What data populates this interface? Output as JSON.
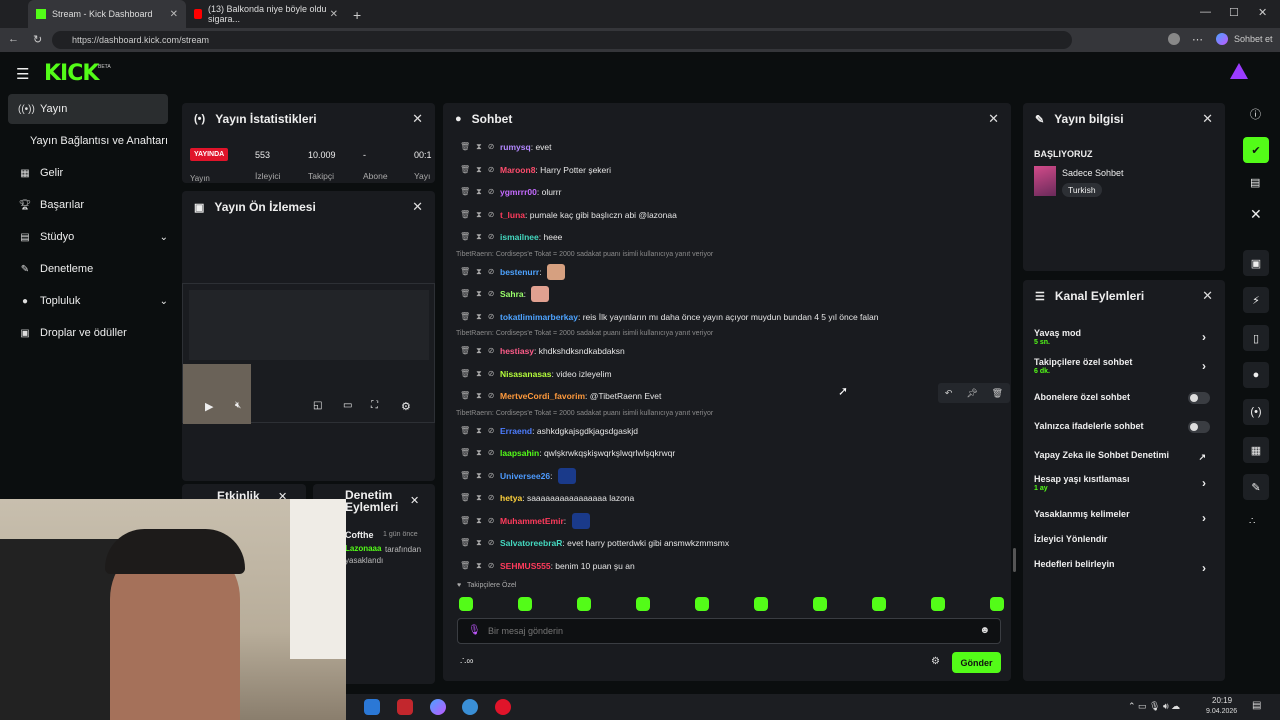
{
  "browser": {
    "tabs": [
      {
        "label": "Stream - Kick Dashboard"
      },
      {
        "label": "(13) Balkonda niye böyle oldu sigara..."
      }
    ],
    "url": "https://dashboard.kick.com/stream",
    "copilot_label": "Sohbet et"
  },
  "kick": {
    "logo": "KICK",
    "beta": "BETA"
  },
  "sidebar": {
    "items": [
      {
        "label": "Yayın",
        "icon": "broadcast-icon"
      },
      {
        "label": "Yayın Bağlantısı ve Anahtarı",
        "icon": ""
      },
      {
        "label": "Gelir",
        "icon": "chart-icon"
      },
      {
        "label": "Başarılar",
        "icon": "trophy-icon"
      },
      {
        "label": "Stüdyo",
        "icon": "studio-icon"
      },
      {
        "label": "Denetleme",
        "icon": "wrench-icon"
      },
      {
        "label": "Topluluk",
        "icon": "people-icon"
      },
      {
        "label": "Droplar ve ödüller",
        "icon": "gift-icon"
      }
    ]
  },
  "stats": {
    "title": "Yayın İstatistikleri",
    "live_badge": "YAYINDA",
    "items": [
      {
        "value": "",
        "label": "Yayın"
      },
      {
        "value": "553",
        "label": "İzleyici"
      },
      {
        "value": "10.009",
        "label": "Takipçi"
      },
      {
        "value": "-",
        "label": "Abone"
      },
      {
        "value": "00:1",
        "label": "Yayı"
      }
    ]
  },
  "preview": {
    "title": "Yayın Ön İzlemesi"
  },
  "etkinlik": {
    "title": "Etkinlik"
  },
  "moderation": {
    "title": "Denetim Eylemleri",
    "user": "Cofthe",
    "time": "1 gün önce",
    "actor": "Lazonaaa",
    "text": "tarafından yasaklandı"
  },
  "chat": {
    "title": "Sohbet",
    "messages": [
      {
        "user": "rumysq",
        "color": "#b388ff",
        "text": "evet"
      },
      {
        "user": "Maroon8",
        "color": "#ff4d6d",
        "text": "Harry Potter şekeri"
      },
      {
        "user": "ygmrrr00",
        "color": "#c56bff",
        "text": "olurrr"
      },
      {
        "user": "t_luna",
        "color": "#ff3b5c",
        "text": "pumale kaç gibi başlıczn abi @lazonaa"
      },
      {
        "user": "ismailnee",
        "color": "#44d9c0",
        "text": "heee"
      },
      {
        "reply": "TibetRaenn: Cordiseps'e Tokat = 2000 sadakat puanı isimli kullanıcıya yanıt veriyor"
      },
      {
        "user": "bestenurr",
        "color": "#4da3ff",
        "text": "",
        "emote": "#d6a080"
      },
      {
        "user": "Sahra",
        "color": "#9aff6b",
        "text": "",
        "emote": "#e0a090"
      },
      {
        "user": "tokatlimimarberkay",
        "color": "#4da3ff",
        "text": "reis İlk yayınların mı daha önce yayın açıyor muydun bundan 4 5 yıl önce falan"
      },
      {
        "reply": "TibetRaenn: Cordiseps'e Tokat = 2000 sadakat puanı isimli kullanıcıya yanıt veriyor"
      },
      {
        "user": "hestiasy",
        "color": "#ff5c8a",
        "text": "khdkshdksndkabdaksn"
      },
      {
        "user": "Nisasanasas",
        "color": "#b6ff3b",
        "text": "video izleyelim"
      },
      {
        "user": "MertveCordi_favorim",
        "color": "#ff9a3c",
        "text": "@TibetRaenn Evet"
      },
      {
        "reply": "TibetRaenn: Cordiseps'e Tokat = 2000 sadakat puanı isimli kullanıcıya yanıt veriyor"
      },
      {
        "user": "Erraend",
        "color": "#4d7dff",
        "text": "ashkdgkajsgdkjagsdgaskjd"
      },
      {
        "user": "laapsahin",
        "color": "#53fc18",
        "text": "qwlşkrwkqşkişwqrkşlwqrlwlşqkrwqr"
      },
      {
        "user": "Universee26",
        "color": "#4d9bff",
        "text": "",
        "emote": "#1a3a8a"
      },
      {
        "user": "hetya",
        "color": "#ffd23c",
        "text": "saaaaaaaaaaaaaaaa lazona"
      },
      {
        "user": "MuhammetEmir",
        "color": "#ff3b5c",
        "text": "",
        "emote": "#1a3a8a"
      },
      {
        "user": "SalvatoreebraR",
        "color": "#44d9c0",
        "text": "evet harry potterdwki gibi ansmwkzmmsmx"
      },
      {
        "user": "SEHMUS555",
        "color": "#ff3b5c",
        "text": "benim 10 puan şu an"
      }
    ],
    "followers_only": "Takipçilere Özel",
    "placeholder": "Bir mesaj gönderin",
    "send_label": "Gönder"
  },
  "stream_info": {
    "title": "Yayın bilgisi",
    "stream_title": "BAŞLIYORUZ",
    "category": "Sadece Sohbet",
    "tag": "Turkish"
  },
  "channel_actions": {
    "title": "Kanal Eylemleri",
    "items": [
      {
        "label": "Yavaş mod",
        "sub": "5 sn.",
        "control": "chevron"
      },
      {
        "label": "Takipçilere özel sohbet",
        "sub": "6 dk.",
        "control": "chevron"
      },
      {
        "label": "Abonelere özel sohbet",
        "sub": "",
        "control": "toggle"
      },
      {
        "label": "Yalnızca ifadelerle sohbet",
        "sub": "",
        "control": "toggle"
      },
      {
        "label": "Yapay Zeka ile Sohbet Denetimi",
        "sub": "",
        "control": "external"
      },
      {
        "label": "Hesap yaşı kısıtlaması",
        "sub": "1 ay",
        "control": "chevron"
      },
      {
        "label": "Yasaklanmış kelimeler",
        "sub": "",
        "control": "chevron"
      },
      {
        "label": "İzleyici Yönlendir",
        "sub": "",
        "control": "none"
      },
      {
        "label": "Hedefleri belirleyin",
        "sub": "",
        "control": "chevron"
      }
    ]
  },
  "taskbar": {
    "time": "20:19",
    "date": "9.04.2026"
  },
  "colors": {
    "accent": "#53fc18",
    "panel": "#191b1f",
    "live": "#e0142a"
  }
}
